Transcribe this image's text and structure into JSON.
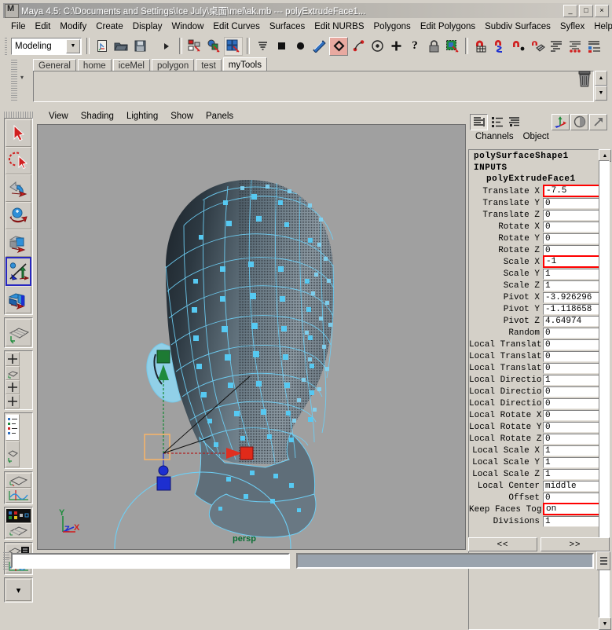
{
  "window": {
    "title": "Maya 4.5: C:\\Documents and Settings\\Ice July\\桌面\\mel\\ak.mb  ---  polyExtrudeFace1...",
    "app_icon": "maya-icon",
    "buttons": {
      "minimize": "_",
      "maximize": "□",
      "close": "×"
    }
  },
  "menubar": {
    "items": [
      "File",
      "Edit",
      "Modify",
      "Create",
      "Display",
      "Window",
      "Edit Curves",
      "Surfaces",
      "Edit NURBS",
      "Polygons",
      "Edit Polygons",
      "Subdiv Surfaces",
      "Syflex",
      "Help"
    ]
  },
  "statusline": {
    "menu_set": "Modeling",
    "icons": [
      "new-scene-icon",
      "open-scene-icon",
      "save-scene-icon",
      "select-by-hierarchy-icon",
      "select-by-object-type-icon",
      "select-by-component-type-icon",
      "snap-to-grids-icon",
      "snap-to-curves-icon",
      "snap-to-points-icon",
      "snap-to-view-planes-icon",
      "construction-history-icon",
      "render-current-frame-icon",
      "ipr-render-icon",
      "render-globals-icon",
      "add-icon",
      "help-icon",
      "lock-icon",
      "selection-mask-icon",
      "magnet-grid-icon",
      "magnet-curve-icon",
      "magnet-point-icon",
      "magnet-view-icon",
      "show-manipulator-icon",
      "attribute-editor-icon",
      "channel-box-icon"
    ]
  },
  "shelf": {
    "tabs": [
      "General",
      "home",
      "iceMel",
      "polygon",
      "test",
      "myTools"
    ],
    "active_tab": "myTools",
    "trash_icon": "trash-icon"
  },
  "toolbox": {
    "tools": [
      {
        "name": "select-tool",
        "selected": false
      },
      {
        "name": "lasso-select-tool",
        "selected": false
      },
      {
        "name": "move-tool",
        "selected": false
      },
      {
        "name": "rotate-tool",
        "selected": false
      },
      {
        "name": "scale-tool",
        "selected": false
      },
      {
        "name": "universal-manipulator-tool",
        "selected": true
      },
      {
        "name": "soft-modification-tool",
        "selected": false
      }
    ],
    "layouts": [
      "single-perspective-layout",
      "four-view-layout",
      "two-pane-side-layout",
      "two-pane-stacked-layout",
      "outliner-persp-layout",
      "persp-graph-layout",
      "hypergraph-layout",
      "persp-outliner-layout",
      "persp-hypershade-layout",
      "persp-graph-editor-layout",
      "more-layouts-dropdown"
    ]
  },
  "viewport": {
    "menus": [
      "View",
      "Shading",
      "Lighting",
      "Show",
      "Panels"
    ],
    "camera_label": "persp",
    "background_color": "#a0a0a0",
    "wireframe_color": "#6ecff5",
    "axis_gizmo": {
      "y": "Y",
      "z": "Z",
      "x": "X"
    },
    "manipulator": {
      "x_handle_color": "#e03020",
      "y_handle_color": "#1f8b3c",
      "z_handle_color": "#1d2fd0",
      "center_box_color": "#f2b36b"
    }
  },
  "channelbox": {
    "icons": [
      "channel-box-layers-icon",
      "channel-box-list-icon",
      "channel-box-expand-icon"
    ],
    "right_icons": [
      "show-manipulator-icon",
      "attribute-editor-icon",
      "channel-box-arrow-icon"
    ],
    "menus": [
      "Channels",
      "Object"
    ],
    "node_title": "polySurfaceShape1",
    "section": "INPUTS",
    "input_node": "polyExtrudeFace1",
    "attributes": [
      {
        "label": "Translate X",
        "value": "-7.5",
        "highlighted": true
      },
      {
        "label": "Translate Y",
        "value": "0",
        "highlighted": false
      },
      {
        "label": "Translate Z",
        "value": "0",
        "highlighted": false
      },
      {
        "label": "Rotate X",
        "value": "0",
        "highlighted": false
      },
      {
        "label": "Rotate Y",
        "value": "0",
        "highlighted": false
      },
      {
        "label": "Rotate Z",
        "value": "0",
        "highlighted": false
      },
      {
        "label": "Scale X",
        "value": "-1",
        "highlighted": true
      },
      {
        "label": "Scale Y",
        "value": "1",
        "highlighted": false
      },
      {
        "label": "Scale Z",
        "value": "1",
        "highlighted": false
      },
      {
        "label": "Pivot X",
        "value": "-3.926296",
        "highlighted": false
      },
      {
        "label": "Pivot Y",
        "value": "-1.118658",
        "highlighted": false
      },
      {
        "label": "Pivot Z",
        "value": "4.64974",
        "highlighted": false
      },
      {
        "label": "Random",
        "value": "0",
        "highlighted": false
      },
      {
        "label": "Local Translat",
        "value": "0",
        "highlighted": false
      },
      {
        "label": "Local Translat",
        "value": "0",
        "highlighted": false
      },
      {
        "label": "Local Translat",
        "value": "0",
        "highlighted": false
      },
      {
        "label": "Local Directio",
        "value": "1",
        "highlighted": false
      },
      {
        "label": "Local Directio",
        "value": "0",
        "highlighted": false
      },
      {
        "label": "Local Directio",
        "value": "0",
        "highlighted": false
      },
      {
        "label": "Local Rotate X",
        "value": "0",
        "highlighted": false
      },
      {
        "label": "Local Rotate Y",
        "value": "0",
        "highlighted": false
      },
      {
        "label": "Local Rotate Z",
        "value": "0",
        "highlighted": false
      },
      {
        "label": "Local Scale X",
        "value": "1",
        "highlighted": false
      },
      {
        "label": "Local Scale Y",
        "value": "1",
        "highlighted": false
      },
      {
        "label": "Local Scale Z",
        "value": "1",
        "highlighted": false
      },
      {
        "label": "Local Center",
        "value": "middle",
        "highlighted": false
      },
      {
        "label": "Offset",
        "value": "0",
        "highlighted": false
      },
      {
        "label": "Keep Faces Tog",
        "value": "on",
        "highlighted": true
      },
      {
        "label": "Divisions",
        "value": "1",
        "highlighted": false
      }
    ],
    "nav_prev": "<<",
    "nav_next": ">>"
  },
  "bottom": {
    "command_line_value": "",
    "help_line_value": "",
    "toggle_icon": "command-feedback-toggle-icon"
  },
  "colors": {
    "chrome": "#d4d0c8",
    "viewport_bg": "#a0a0a0",
    "highlight_red": "#ff0000",
    "wire_cyan": "#6ecff5",
    "persp_green": "#086d32"
  }
}
